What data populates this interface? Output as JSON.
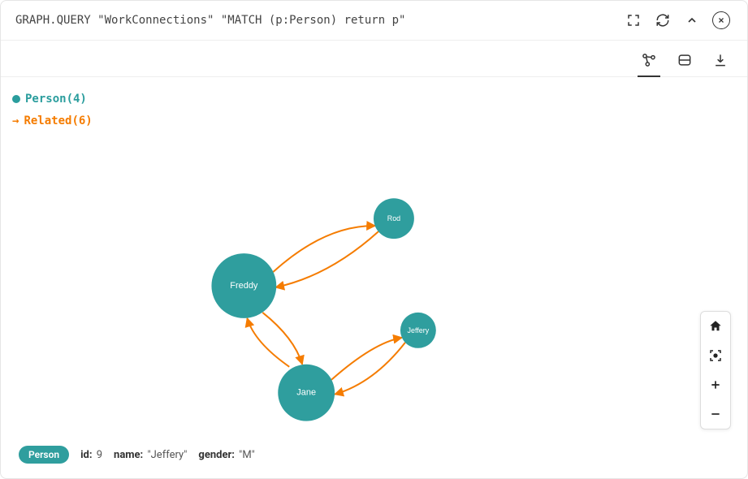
{
  "query": "GRAPH.QUERY \"WorkConnections\" \"MATCH (p:Person) return p\"",
  "legend": {
    "node_label": "Person",
    "node_count": "(4)",
    "edge_label": "Related",
    "edge_count": "(6)"
  },
  "nodes": {
    "freddy": "Freddy",
    "rod": "Rod",
    "jane": "Jane",
    "jeffery": "Jeffery"
  },
  "selected": {
    "badge": "Person",
    "id_label": "id:",
    "id_value": "9",
    "name_label": "name:",
    "name_value": "\"Jeffery\"",
    "gender_label": "gender:",
    "gender_value": "\"M\""
  },
  "chart_data": {
    "type": "graph",
    "node_type": "Person",
    "edge_type": "Related",
    "nodes": [
      {
        "id": "Freddy"
      },
      {
        "id": "Rod"
      },
      {
        "id": "Jane"
      },
      {
        "id": "Jeffery"
      }
    ],
    "edges": [
      {
        "from": "Freddy",
        "to": "Rod"
      },
      {
        "from": "Rod",
        "to": "Freddy"
      },
      {
        "from": "Freddy",
        "to": "Jane"
      },
      {
        "from": "Jane",
        "to": "Freddy"
      },
      {
        "from": "Jane",
        "to": "Jeffery"
      },
      {
        "from": "Jeffery",
        "to": "Jane"
      }
    ],
    "node_count": 4,
    "edge_count": 6
  }
}
